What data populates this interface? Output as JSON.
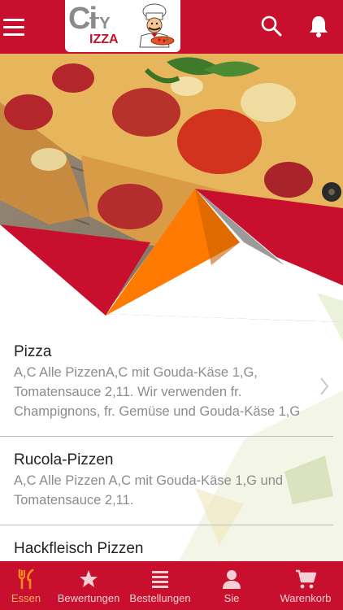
{
  "appbar": {
    "logo_text_big": "Ci",
    "logo_text_ty": "TY",
    "logo_text_izza": "IZZA",
    "icons": [
      "menu-icon",
      "search-icon",
      "bell-icon"
    ]
  },
  "colors": {
    "primary": "#c8102e",
    "accent": "#ff7a00",
    "text_primary": "#222222",
    "text_secondary": "#8c8c8c"
  },
  "categories": [
    {
      "title": "Pizza",
      "description": "A,C Alle PizzenA,C mit Gouda-Käse 1,G, Tomatensauce 2,11. Wir verwenden fr. Champignons, fr. Gemüse und Gouda-Käse 1,G"
    },
    {
      "title": "Rucola-Pizzen",
      "description": "A,C Alle Pizzen A,C mit Gouda-Käse 1,G und Tomatensauce 2,11."
    },
    {
      "title": "Hackfleisch Pizzen",
      "description": ""
    }
  ],
  "bottom_nav": [
    {
      "label": "Essen",
      "icon": "fork-knife-icon",
      "active": true
    },
    {
      "label": "Bewertungen",
      "icon": "star-icon",
      "active": false
    },
    {
      "label": "Bestellungen",
      "icon": "list-icon",
      "active": false
    },
    {
      "label": "Sie",
      "icon": "person-icon",
      "active": false
    },
    {
      "label": "Warenkorb",
      "icon": "cart-icon",
      "active": false
    }
  ]
}
